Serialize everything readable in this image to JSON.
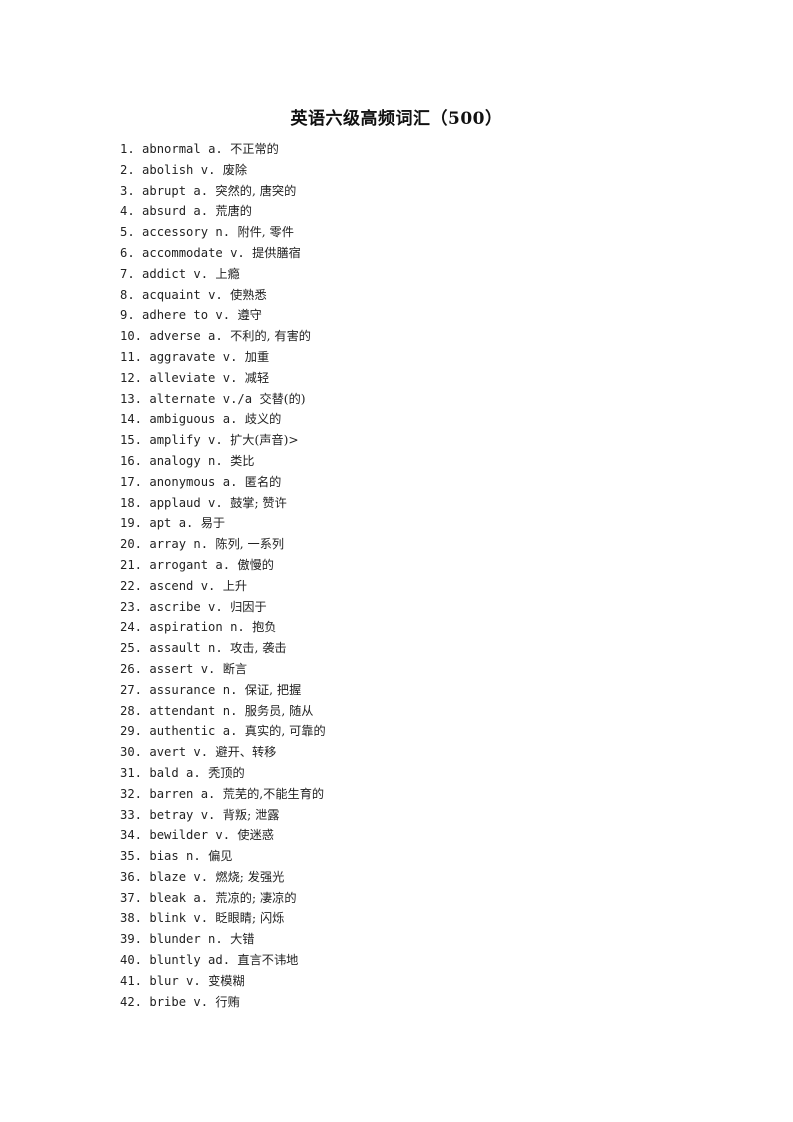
{
  "document": {
    "title": "英语六级高频词汇（500）",
    "entries": [
      {
        "num": "1.",
        "word": "abnormal a.",
        "def": "不正常的"
      },
      {
        "num": "2.",
        "word": "abolish v.",
        "def": "废除"
      },
      {
        "num": "3.",
        "word": "abrupt a.",
        "def": "突然的, 唐突的"
      },
      {
        "num": "4.",
        "word": "absurd a.",
        "def": "荒唐的"
      },
      {
        "num": "5.",
        "word": "accessory n.",
        "def": "附件, 零件"
      },
      {
        "num": "6.",
        "word": "accommodate v.",
        "def": "提供膳宿"
      },
      {
        "num": "7.",
        "word": "addict v.",
        "def": "上瘾"
      },
      {
        "num": "8.",
        "word": "acquaint v.",
        "def": "使熟悉"
      },
      {
        "num": "9.",
        "word": "adhere to v.",
        "def": "遵守"
      },
      {
        "num": "10.",
        "word": "adverse a.",
        "def": "不利的, 有害的"
      },
      {
        "num": "11.",
        "word": "aggravate v.",
        "def": "加重"
      },
      {
        "num": "12.",
        "word": "alleviate v.",
        "def": "减轻"
      },
      {
        "num": "13.",
        "word": "alternate v./a",
        "def": "交替(的)"
      },
      {
        "num": "14.",
        "word": "ambiguous a.",
        "def": "歧义的"
      },
      {
        "num": "15.",
        "word": "amplify v.",
        "def": "扩大(声音)>"
      },
      {
        "num": "16.",
        "word": "analogy n.",
        "def": "类比"
      },
      {
        "num": "17.",
        "word": "anonymous a.",
        "def": "匿名的"
      },
      {
        "num": "18.",
        "word": "applaud v.",
        "def": "鼓掌; 赞许"
      },
      {
        "num": "19.",
        "word": "apt a.",
        "def": "易于"
      },
      {
        "num": "20.",
        "word": "array n.",
        "def": "陈列, 一系列"
      },
      {
        "num": "21.",
        "word": "arrogant a.",
        "def": "傲慢的"
      },
      {
        "num": "22.",
        "word": "ascend v.",
        "def": "上升"
      },
      {
        "num": "23.",
        "word": "ascribe v.",
        "def": "归因于"
      },
      {
        "num": "24.",
        "word": "aspiration n.",
        "def": "抱负"
      },
      {
        "num": "25.",
        "word": "assault n.",
        "def": "攻击, 袭击"
      },
      {
        "num": "26.",
        "word": "assert v.",
        "def": "断言"
      },
      {
        "num": "27.",
        "word": "assurance n.",
        "def": "保证, 把握"
      },
      {
        "num": "28.",
        "word": "attendant n.",
        "def": "服务员, 随从"
      },
      {
        "num": "29.",
        "word": "authentic a.",
        "def": "真实的, 可靠的"
      },
      {
        "num": "30.",
        "word": "avert v.",
        "def": "避开、转移"
      },
      {
        "num": "31.",
        "word": "bald a.",
        "def": "秃顶的"
      },
      {
        "num": "32.",
        "word": "barren a.",
        "def": "荒芜的,不能生育的"
      },
      {
        "num": "33.",
        "word": "betray v.",
        "def": "背叛; 泄露"
      },
      {
        "num": "34.",
        "word": "bewilder v.",
        "def": "使迷惑"
      },
      {
        "num": "35.",
        "word": "bias n.",
        "def": "偏见"
      },
      {
        "num": "36.",
        "word": "blaze v.",
        "def": "燃烧; 发强光"
      },
      {
        "num": "37.",
        "word": "bleak a.",
        "def": "荒凉的; 凄凉的"
      },
      {
        "num": "38.",
        "word": "blink v.",
        "def": "眨眼睛; 闪烁"
      },
      {
        "num": "39.",
        "word": "blunder n.",
        "def": "大错"
      },
      {
        "num": "40.",
        "word": "bluntly ad.",
        "def": "直言不讳地"
      },
      {
        "num": "41.",
        "word": "blur v.",
        "def": "变模糊"
      },
      {
        "num": "42.",
        "word": "bribe v.",
        "def": "行贿"
      }
    ]
  }
}
